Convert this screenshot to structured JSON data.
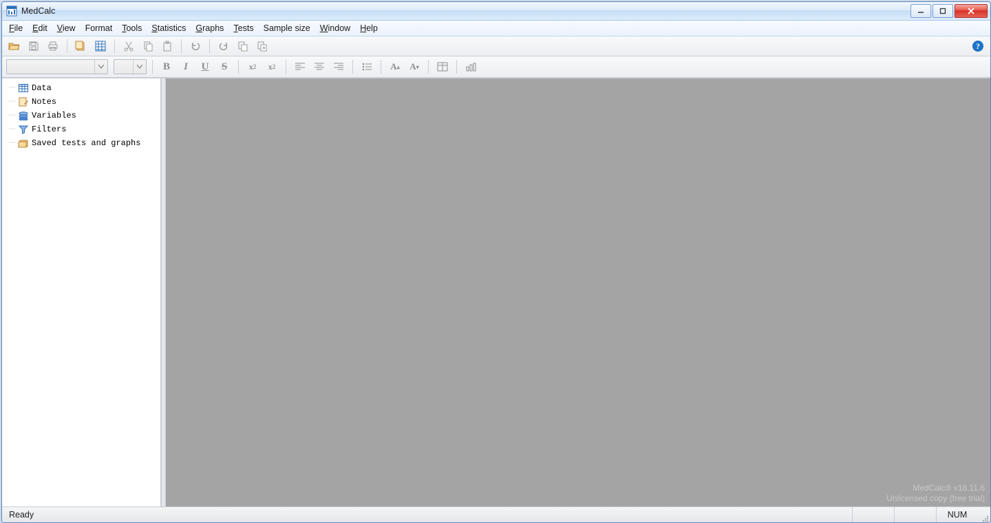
{
  "titlebar": {
    "title": "MedCalc"
  },
  "menu": {
    "file": {
      "u": "F",
      "rest": "ile"
    },
    "edit": {
      "u": "E",
      "rest": "dit"
    },
    "view": {
      "u": "V",
      "rest": "iew"
    },
    "format": {
      "u": "",
      "rest": "Format"
    },
    "tools": {
      "u": "T",
      "rest": "ools"
    },
    "statistics": {
      "u": "S",
      "rest": "tatistics"
    },
    "graphs": {
      "u": "G",
      "rest": "raphs"
    },
    "tests": {
      "u": "T",
      "rest": "ests"
    },
    "sample": {
      "u": "",
      "rest": "Sample size"
    },
    "window": {
      "u": "W",
      "rest": "indow"
    },
    "help": {
      "u": "H",
      "rest": "elp"
    }
  },
  "format_toolbar": {
    "font_name": "",
    "font_size": ""
  },
  "sidebar": {
    "items": [
      {
        "icon": "grid",
        "label": "Data"
      },
      {
        "icon": "notes",
        "label": "Notes"
      },
      {
        "icon": "vars",
        "label": "Variables"
      },
      {
        "icon": "filter",
        "label": "Filters"
      },
      {
        "icon": "folder",
        "label": "Saved tests and graphs"
      }
    ]
  },
  "watermark": {
    "line1": "MedCalc® v18.11.6",
    "line2": "Unlicensed copy (free trial)"
  },
  "status": {
    "left": "Ready",
    "num": "NUM"
  }
}
